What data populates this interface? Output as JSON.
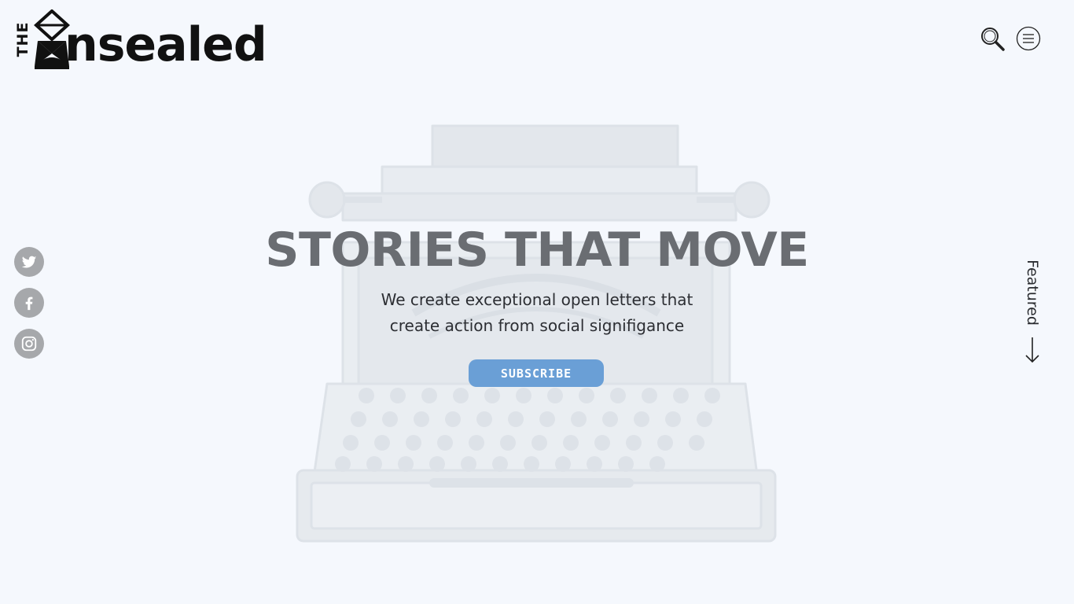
{
  "logo": {
    "the": "THE",
    "word": "nsealed"
  },
  "header": {
    "search_icon": "search-icon",
    "menu_icon": "menu-icon"
  },
  "social": [
    {
      "name": "twitter",
      "icon": "twitter-icon"
    },
    {
      "name": "facebook",
      "icon": "facebook-icon"
    },
    {
      "name": "instagram",
      "icon": "instagram-icon"
    }
  ],
  "hero": {
    "title": "STORIES THAT MOVE",
    "subtitle_line1": "We create exceptional open letters that",
    "subtitle_line2": "create action from social signifigance",
    "subscribe_label": "SUBSCRIBE",
    "background_image": "typewriter-illustration"
  },
  "featured": {
    "label": "Featured",
    "icon": "arrow-down-icon"
  },
  "colors": {
    "background": "#f5f8fd",
    "title": "#6a6d72",
    "subscribe_button": "#6a9fd6",
    "social_button": "#a6a8ab",
    "text": "#2c2e33"
  }
}
